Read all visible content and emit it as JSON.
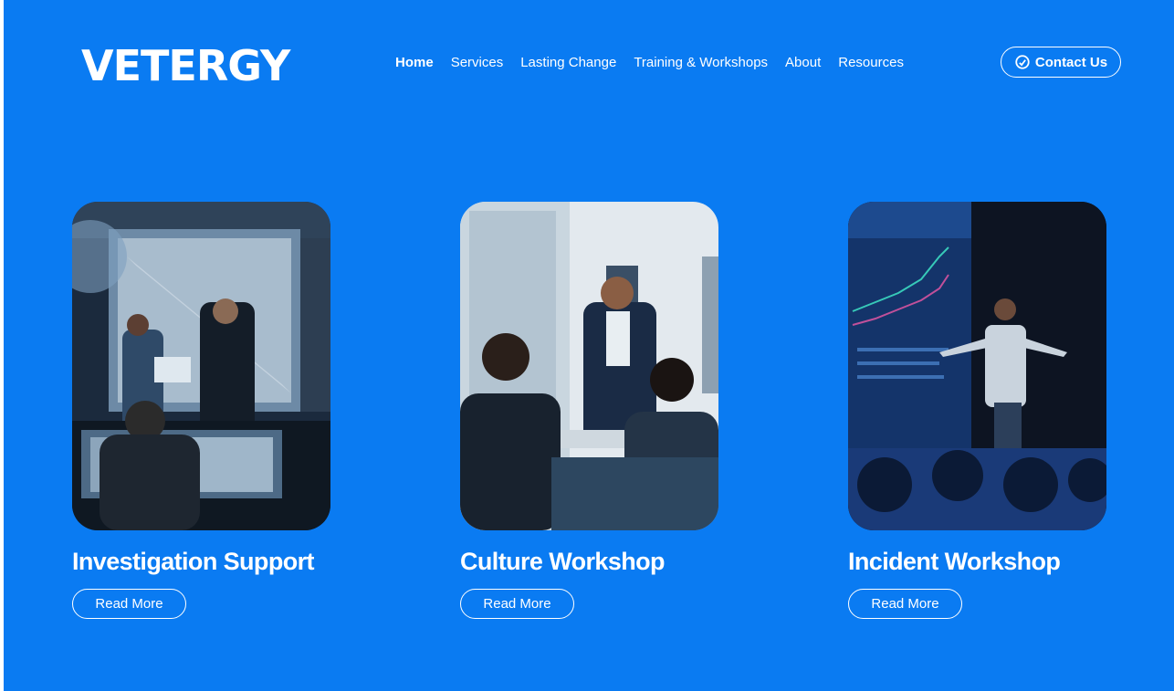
{
  "header": {
    "logo": "VETERGY",
    "nav": [
      {
        "label": "Home",
        "active": true
      },
      {
        "label": "Services",
        "active": false
      },
      {
        "label": "Lasting Change",
        "active": false
      },
      {
        "label": "Training & Workshops",
        "active": false
      },
      {
        "label": "About",
        "active": false
      },
      {
        "label": "Resources",
        "active": false
      }
    ],
    "contact_label": "Contact Us",
    "contact_icon": "headset-icon"
  },
  "cards": [
    {
      "title": "Investigation Support",
      "button": "Read More",
      "image": "control-room-photo"
    },
    {
      "title": "Culture Workshop",
      "button": "Read More",
      "image": "meeting-applause-photo"
    },
    {
      "title": "Incident Workshop",
      "button": "Read More",
      "image": "stage-presenter-photo"
    }
  ],
  "colors": {
    "background": "#0a7bf2",
    "text": "#ffffff"
  }
}
